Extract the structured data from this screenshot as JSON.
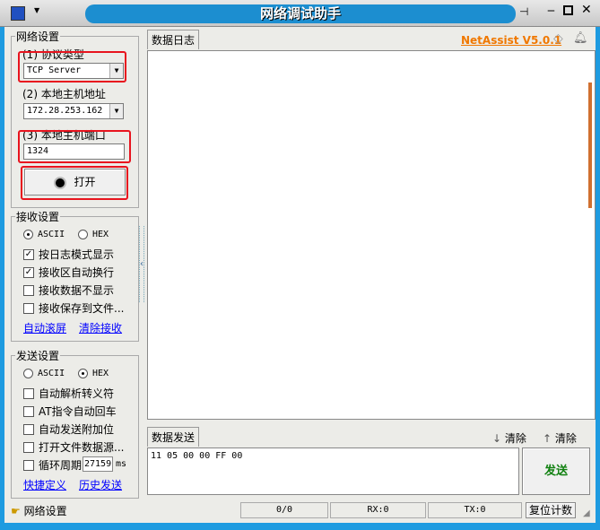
{
  "window": {
    "title": "网络调试助手"
  },
  "header": {
    "version_link": "NetAssist V5.0.1"
  },
  "network_settings": {
    "title": "网络设置",
    "protocol_label": "(1) 协议类型",
    "protocol_value": "TCP Server",
    "host_label": "(2) 本地主机地址",
    "host_value": "172.28.253.162",
    "port_label": "(3) 本地主机端口",
    "port_value": "1324",
    "open_button": "打开"
  },
  "receive_settings": {
    "title": "接收设置",
    "ascii": "ASCII",
    "hex": "HEX",
    "selected": "ASCII",
    "options": [
      {
        "label": "按日志模式显示",
        "checked": true
      },
      {
        "label": "接收区自动换行",
        "checked": true
      },
      {
        "label": "接收数据不显示",
        "checked": false
      },
      {
        "label": "接收保存到文件...",
        "checked": false
      }
    ],
    "link_autoscroll": "自动滚屏",
    "link_clear": "清除接收"
  },
  "send_settings": {
    "title": "发送设置",
    "ascii": "ASCII",
    "hex": "HEX",
    "selected": "HEX",
    "options": [
      {
        "label": "自动解析转义符",
        "checked": false
      },
      {
        "label": "AT指令自动回车",
        "checked": false
      },
      {
        "label": "自动发送附加位",
        "checked": false
      },
      {
        "label": "打开文件数据源...",
        "checked": false
      }
    ],
    "loop_label": "循环周期",
    "loop_value": "27159",
    "loop_unit": "ms",
    "link_shortcut": "快捷定义",
    "link_history": "历史发送"
  },
  "log": {
    "tab": "数据日志"
  },
  "send": {
    "tab": "数据发送",
    "clear1": "清除",
    "clear2": "清除",
    "content": "11 05 00 00 FF 00",
    "send_button": "发送"
  },
  "status": {
    "label": "网络设置",
    "count": "0/0",
    "rx": "RX:0",
    "tx": "TX:0",
    "reset": "复位计数"
  },
  "colors": {
    "accent": "#1c8ed0",
    "highlight": "#e8141e",
    "link_orange": "#f07800",
    "send_green": "#108010"
  }
}
